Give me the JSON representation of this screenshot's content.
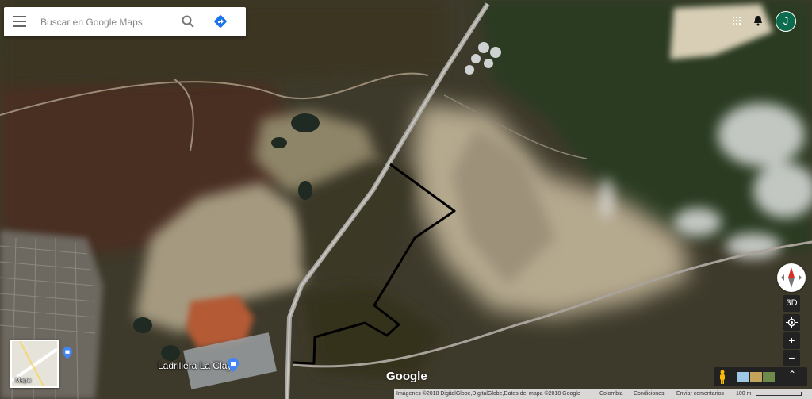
{
  "search": {
    "placeholder": "Buscar en Google Maps"
  },
  "header": {
    "avatar_letter": "J"
  },
  "icons": {
    "menu": "menu-icon",
    "search": "search-icon",
    "directions": "directions-icon",
    "apps": "apps-icon",
    "notifications": "bell-icon",
    "pegman": "pegman-icon",
    "layers": "layers-icon"
  },
  "map": {
    "place_label": "Ladrillera La Clay",
    "logo": "Google"
  },
  "layer_toggle": {
    "label": "Mapa"
  },
  "controls": {
    "tilt_label": "3D",
    "zoom_in": "+",
    "zoom_out": "−",
    "expand": "⌃"
  },
  "footer": {
    "imagery": "Imágenes ©2018 DigitalGlobe,DigitalGlobe,Datos del mapa ©2018 Google",
    "country": "Colombia",
    "terms": "Condiciones",
    "feedback": "Enviar comentarios",
    "scale": "100 m"
  },
  "colors": {
    "accent": "#1a73e8",
    "route": "#000000",
    "avatar": "#0b6b4c"
  }
}
